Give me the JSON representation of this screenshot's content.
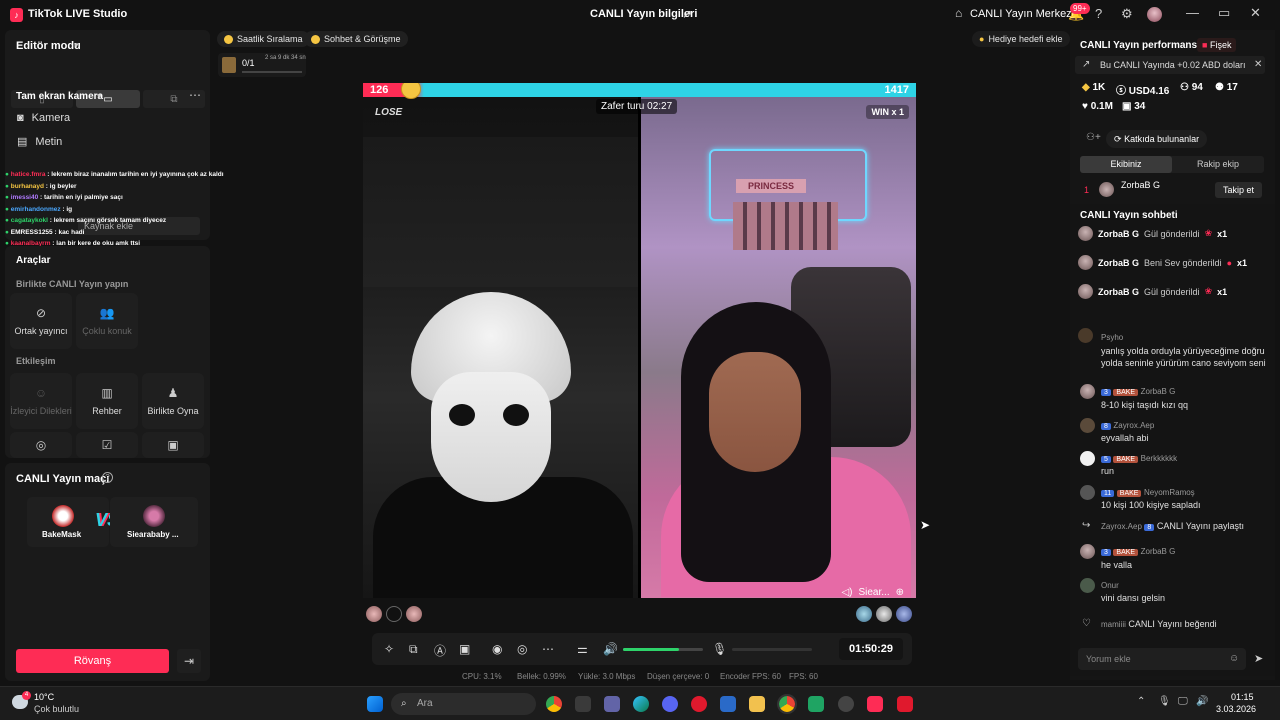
{
  "titlebar": {
    "app_name": "TikTok LIVE Studio",
    "center_title": "CANLI Yayın bilgileri",
    "center_link": "CANLI Yayın Merkezi",
    "notif_badge": "99+"
  },
  "left": {
    "editor_mode": "Editör modu",
    "camera_section": "Tam ekran kamera",
    "menu_kamera": "Kamera",
    "menu_metin": "Metin",
    "source_add": "Kaynak ekle",
    "tools_title": "Araçlar",
    "collab_title": "Birlikte CANLI Yayın yapın",
    "tool_cohost": "Ortak yayıncı",
    "tool_multi": "Çoklu konuk",
    "interaction_title": "Etkileşim",
    "tool_requests": "İzleyici Dilekleri",
    "tool_guide": "Rehber",
    "tool_play": "Birlikte Oyna",
    "match_title": "CANLI Yayın maçı",
    "player1": "BakeMask",
    "player2": "Siearababy ...",
    "rematch": "Rövanş",
    "chat": [
      {
        "name": "hatice.fmra",
        "text": "lekrem biraz inanalım tarihin en iyi yayınına çok az kaldı",
        "color": "#fe2c55"
      },
      {
        "name": "burhanayd",
        "text": "ig beyler",
        "color": "#f5c542"
      },
      {
        "name": "imessi40",
        "text": "tarihin en iyi palmiye saçı",
        "color": "#b07aff"
      },
      {
        "name": "emirhandonmez",
        "text": "ig",
        "color": "#4aa8ff"
      },
      {
        "name": "cagataykokl",
        "text": "lekrem saçını görsek tamam diyecez",
        "color": "#2ed36a"
      },
      {
        "name": "EMRESS1255",
        "text": "kac hadi",
        "color": "#ffffff"
      },
      {
        "name": "kaanalbayrm",
        "text": "lan bir kere de oku amk ttsi",
        "color": "#fe2c55"
      },
      {
        "name": "EMRESS1255",
        "text": "kac sana amk",
        "color": "#ffffff"
      }
    ]
  },
  "center": {
    "pill_ranking": "Saatlik Sıralama",
    "pill_chat": "Sohbet & Görüşme",
    "gift_goal": "Hediye hedefi ekle",
    "counter": "0/1",
    "counter_time": "2 sa 9 dk 34 sn",
    "score_left": "126",
    "score_right": "1417",
    "lose_label": "LOSE",
    "win_label": "WIN x 1",
    "round_timer": "Zafer turu 02:27",
    "opponent_short": "Siear...",
    "sign_text": "PRINCESS",
    "live_clock": "01:50:29",
    "stats": {
      "cpu": "CPU: 3.1%",
      "memory": "Bellek: 0.99%",
      "upload": "Yükle: 3.0 Mbps",
      "dropped": "Düşen çerçeve: 0",
      "encoder": "Encoder FPS: 60",
      "fps": "FPS: 60"
    }
  },
  "right": {
    "perf_title": "CANLI Yayın performansı",
    "fisek": "Fişek",
    "earn_note": "Bu CANLI Yayında +0.02 ABD doları",
    "stat_1k": "1K",
    "stat_usd": "USD4.16",
    "stat_94": "94",
    "stat_17": "17",
    "stat_01m": "0.1M",
    "stat_34": "34",
    "contributors": "Katkıda bulunanlar",
    "tab_team": "Ekibiniz",
    "tab_rival": "Rakip ekip",
    "rank1": "1",
    "rank1_name": "ZorbaB G",
    "follow": "Takip et",
    "chat_title": "CANLI Yayın sohbeti",
    "gifts": [
      {
        "name": "ZorbaB G",
        "text": "Gül gönderildi",
        "mult": "x1"
      },
      {
        "name": "ZorbaB G",
        "text": "Beni Sev gönderildi",
        "mult": "x1"
      },
      {
        "name": "ZorbaB G",
        "text": "Gül gönderildi",
        "mult": "x1"
      }
    ],
    "msg_psyho_name": "Psyho",
    "msg_psyho": "yanlış yolda orduyla yürüyeceğime doğru yolda seninle yürürüm cano seviyom seni",
    "msg2_lv": "3",
    "msg2_name": "ZorbaB G",
    "msg2": "8-10 kişi taşıdı kızı qq",
    "msg3_lv": "8",
    "msg3_name": "Zayrox.Aep",
    "msg3": "eyvallah abi",
    "msg4_lv": "5",
    "msg4_name": "Berkkkkkk",
    "msg4": "run",
    "msg5_lv": "11",
    "msg5_name": "NeyomRamoş",
    "msg5": "10 kişi 100 kişiye sapladı",
    "share_name": "Zayrox.Aep",
    "share_lv": "8",
    "share_text": "CANLI Yayını paylaştı",
    "msg6_lv": "3",
    "msg6_name": "ZorbaB G",
    "msg6": "he valla",
    "msg7_name": "Onur",
    "msg7": "vini dansı gelsin",
    "like_name": "mamiiii",
    "like_text": "CANLI Yayını beğendi",
    "team_badge": "BAKE",
    "comment_placeholder": "Yorum ekle"
  },
  "taskbar": {
    "weather_temp": "10°C",
    "weather_text": "Çok bulutlu",
    "weather_badge": "4",
    "search": "Ara",
    "time": "01:15",
    "date": "3.03.2026"
  },
  "colors": {
    "accent": "#fe2c55",
    "teal": "#2ed3e6",
    "green": "#2ed36a"
  }
}
